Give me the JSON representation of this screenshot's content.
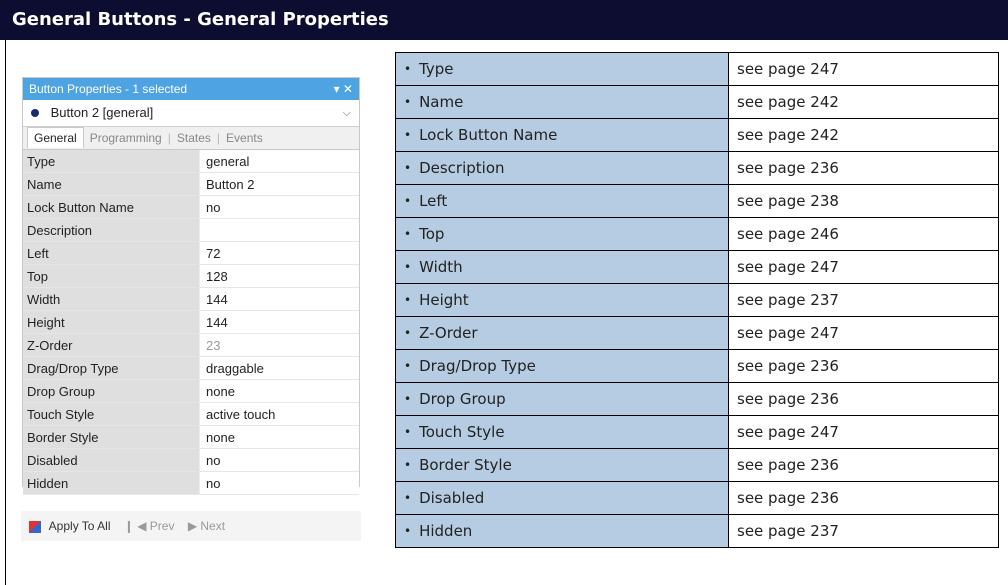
{
  "title": "General Buttons - General Properties",
  "panel": {
    "header": "Button Properties - 1 selected",
    "header_controls": "▾ ✕",
    "selected_item": "Button 2  [general]",
    "tabs": [
      "General",
      "Programming",
      "States",
      "Events"
    ],
    "rows": [
      {
        "key": "Type",
        "value": "general"
      },
      {
        "key": "Name",
        "value": "Button 2"
      },
      {
        "key": "Lock Button Name",
        "value": "no"
      },
      {
        "key": "Description",
        "value": ""
      },
      {
        "key": "Left",
        "value": "72"
      },
      {
        "key": "Top",
        "value": "128"
      },
      {
        "key": "Width",
        "value": "144"
      },
      {
        "key": "Height",
        "value": "144"
      },
      {
        "key": "Z-Order",
        "value": "23"
      },
      {
        "key": "Drag/Drop Type",
        "value": "draggable"
      },
      {
        "key": "Drop Group",
        "value": "none"
      },
      {
        "key": "Touch Style",
        "value": "active touch"
      },
      {
        "key": "Border Style",
        "value": "none"
      },
      {
        "key": "Disabled",
        "value": "no"
      },
      {
        "key": "Hidden",
        "value": "no"
      }
    ],
    "footer": {
      "apply_label": "Apply To All",
      "prev_label": "❙ ◀ Prev",
      "next_label": "▶ Next"
    }
  },
  "references": [
    {
      "name": "Type",
      "page": "see page 247"
    },
    {
      "name": "Name",
      "page": "see page 242"
    },
    {
      "name": "Lock Button Name",
      "page": "see page 242"
    },
    {
      "name": "Description",
      "page": "see page 236"
    },
    {
      "name": "Left",
      "page": "see page 238"
    },
    {
      "name": "Top",
      "page": "see page 246"
    },
    {
      "name": "Width",
      "page": "see page 247"
    },
    {
      "name": "Height",
      "page": "see page 237"
    },
    {
      "name": "Z-Order",
      "page": "see page 247"
    },
    {
      "name": "Drag/Drop Type",
      "page": "see page 236"
    },
    {
      "name": "Drop Group",
      "page": "see page 236"
    },
    {
      "name": "Touch Style",
      "page": "see page 247"
    },
    {
      "name": "Border Style",
      "page": "see page 236"
    },
    {
      "name": "Disabled",
      "page": "see page 236"
    },
    {
      "name": "Hidden",
      "page": "see page 237"
    }
  ],
  "colors": {
    "title_bg": "#0d0c31",
    "name_cell_bg": "#b6cce2",
    "panel_header_bg": "#4ea3e3"
  }
}
